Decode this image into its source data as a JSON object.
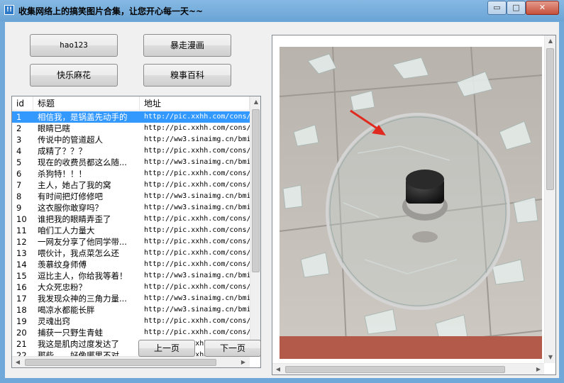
{
  "window": {
    "title": "收集网络上的搞笑图片合集，让您开心每一天~~",
    "icon_label": "!!",
    "controls": {
      "minimize": "▭",
      "maximize": "□",
      "close": "✕"
    }
  },
  "nav_buttons": {
    "hao123": "hao123",
    "baozou": "暴走漫画",
    "kuaile": "快乐麻花",
    "qiushi": "糗事百科"
  },
  "list": {
    "columns": [
      "id",
      "标题",
      "地址"
    ],
    "selected_index": 0,
    "rows": [
      {
        "id": "1",
        "title": "相信我，是锅盖先动手的",
        "url": "http://pic.xxhh.com/cons/"
      },
      {
        "id": "2",
        "title": "眼睛已瞎",
        "url": "http://pic.xxhh.com/cons/"
      },
      {
        "id": "3",
        "title": "传说中的管道超人",
        "url": "http://ww3.sinaimg.cn/bmi"
      },
      {
        "id": "4",
        "title": "成精了？？？",
        "url": "http://pic.xxhh.com/cons/"
      },
      {
        "id": "5",
        "title": "现在的收费员都这么随...",
        "url": "http://ww3.sinaimg.cn/bmi"
      },
      {
        "id": "6",
        "title": "杀狗特！！！",
        "url": "http://pic.xxhh.com/cons/"
      },
      {
        "id": "7",
        "title": "主人，她占了我的窝",
        "url": "http://pic.xxhh.com/cons/"
      },
      {
        "id": "8",
        "title": "有时间把灯修修吧",
        "url": "http://ww3.sinaimg.cn/bmi"
      },
      {
        "id": "9",
        "title": "这衣服你敢穿吗？",
        "url": "http://ww3.sinaimg.cn/bmi"
      },
      {
        "id": "10",
        "title": "谁把我的眼睛弄歪了",
        "url": "http://pic.xxhh.com/cons/"
      },
      {
        "id": "11",
        "title": "咱们工人力量大",
        "url": "http://pic.xxhh.com/cons/"
      },
      {
        "id": "12",
        "title": "一网友分享了他同学带...",
        "url": "http://pic.xxhh.com/cons/"
      },
      {
        "id": "13",
        "title": "喂伙计，我点菜怎么还",
        "url": "http://pic.xxhh.com/cons/"
      },
      {
        "id": "14",
        "title": "羡慕纹身师傅",
        "url": "http://pic.xxhh.com/cons/"
      },
      {
        "id": "15",
        "title": "逗比主人，你给我等着！",
        "url": "http://ww3.sinaimg.cn/bmi"
      },
      {
        "id": "16",
        "title": "大众死忠粉？",
        "url": "http://pic.xxhh.com/cons/"
      },
      {
        "id": "17",
        "title": "我发现众神的三角力量...",
        "url": "http://ww3.sinaimg.cn/bmi"
      },
      {
        "id": "18",
        "title": "喝凉水都能长胖",
        "url": "http://ww3.sinaimg.cn/bmi"
      },
      {
        "id": "19",
        "title": "灵魂出窍",
        "url": "http://pic.xxhh.com/cons/"
      },
      {
        "id": "20",
        "title": "捕获一只野生青蛙",
        "url": "http://pic.xxhh.com/cons/"
      },
      {
        "id": "21",
        "title": "我这是肌肉过度发达了",
        "url": "http://pic.xxhh.com/cons/"
      },
      {
        "id": "22",
        "title": "那些……好像哪里不对",
        "url": "http://pic.xxhh.com/cons/"
      }
    ]
  },
  "pager": {
    "prev": "上一页",
    "next": "下一页"
  },
  "colors": {
    "selection": "#3399ff",
    "titlebar": "#6fa8d9"
  }
}
